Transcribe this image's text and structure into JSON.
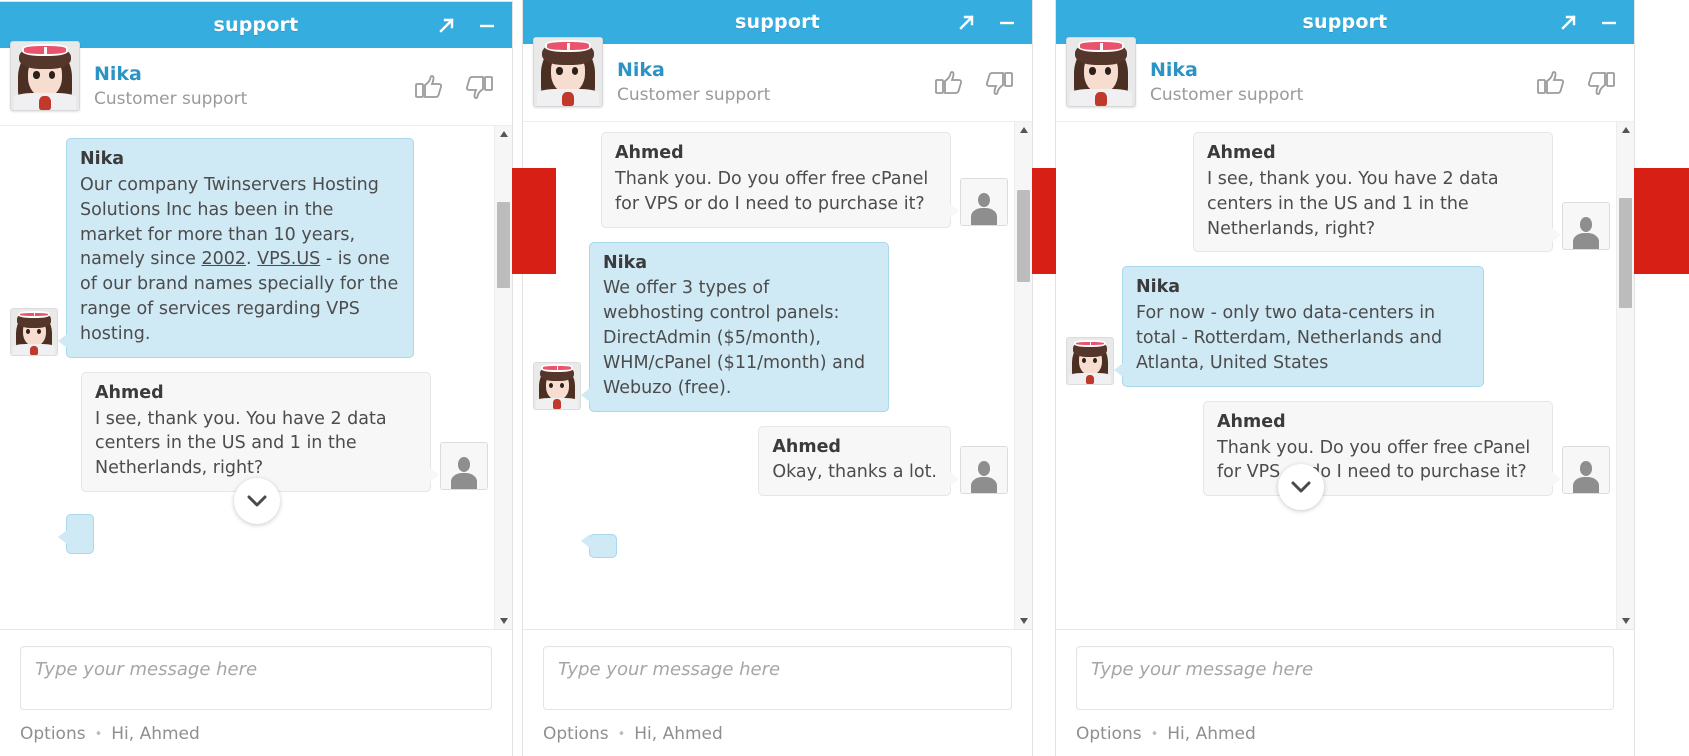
{
  "window": {
    "title": "support",
    "expand_icon": "expand-arrow-icon",
    "minimize_icon": "minimize-icon"
  },
  "agent": {
    "name": "Nika",
    "role": "Customer support",
    "thumbs_up_icon": "thumbs-up-icon",
    "thumbs_down_icon": "thumbs-down-icon"
  },
  "composer": {
    "placeholder": "Type your message here",
    "value": ""
  },
  "footer": {
    "options_label": "Options",
    "separator": "•",
    "greeting": "Hi, Ahmed"
  },
  "colors": {
    "titlebar": "#35adde",
    "agent_name": "#2c93c4",
    "agent_bubble_bg": "#cfe9f5",
    "agent_bubble_border": "#a9d7ec",
    "user_bubble_bg": "#f7f7f7",
    "user_bubble_border": "#e6e6e6",
    "annotation_red": "#d81f16",
    "scrollbar_thumb": "#bcbcbc"
  },
  "panels": [
    {
      "id": "panel-1",
      "messages": [
        {
          "side": "left",
          "author": "Nika",
          "text": "Our company Twinservers Hosting Solutions Inc has been in the market for more than 10 years, namely since 2002. VPS.US - is one of our brand names specially for the range of services regarding VPS hosting.",
          "links": [
            "2002",
            "VPS.US"
          ]
        },
        {
          "side": "right",
          "author": "Ahmed",
          "text": "I see, thank you. You have 2 data centers in the US and 1 in the Netherlands, right?"
        }
      ],
      "scroll_down_icon": "chevron-down-icon",
      "scrollbar": {
        "up_icon": "caret-up-icon",
        "down_icon": "caret-down-icon"
      }
    },
    {
      "id": "panel-2",
      "messages": [
        {
          "side": "right",
          "author": "Ahmed",
          "text": "Thank you. Do you offer free cPanel for VPS or do I need to purchase it?"
        },
        {
          "side": "left",
          "author": "Nika",
          "text": "We offer 3 types of webhosting control panels: DirectAdmin ($5/month), WHM/cPanel ($11/month) and Webuzo (free)."
        },
        {
          "side": "right",
          "author": "Ahmed",
          "text": "Okay, thanks a lot."
        }
      ],
      "scrollbar": {
        "up_icon": "caret-up-icon",
        "down_icon": "caret-down-icon"
      }
    },
    {
      "id": "panel-3",
      "messages": [
        {
          "side": "right",
          "author": "Ahmed",
          "text": "I see, thank you. You have 2 data centers in the US and 1 in the Netherlands, right?"
        },
        {
          "side": "left",
          "author": "Nika",
          "text": "For now - only two data-centers in total - Rotterdam, Netherlands  and\nAtlanta, United States"
        },
        {
          "side": "right",
          "author": "Ahmed",
          "text": "Thank you. Do you offer free cPanel for VPS or do I need to purchase it?"
        }
      ],
      "scroll_down_icon": "chevron-down-icon",
      "scrollbar": {
        "up_icon": "caret-up-icon",
        "down_icon": "caret-down-icon"
      }
    }
  ]
}
